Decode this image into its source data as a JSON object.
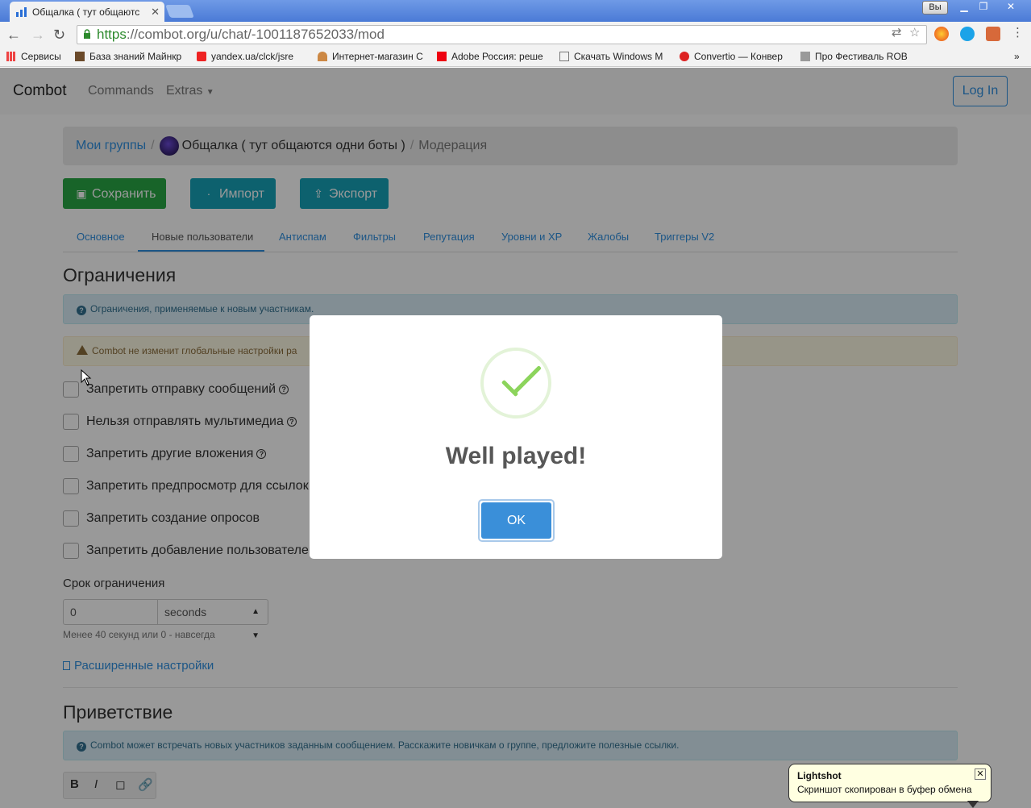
{
  "browser": {
    "tab_title": "Общалка ( тут общаютс",
    "user_button": "Вы",
    "url_https": "https",
    "url_rest": "://combot.org/u/chat/-1001187652033/mod",
    "bookmarks": [
      "Сервисы",
      "База знаний Майнкр",
      "yandex.ua/clck/jsre",
      "Интернет-магазин С",
      "Adobe Россия: реше",
      "Скачать Windows M",
      "Convertio — Конвер",
      "Про Фестиваль ROB"
    ]
  },
  "navbar": {
    "brand": "Combot",
    "commands": "Commands",
    "extras": "Extras",
    "login": "Log In"
  },
  "breadcrumb": {
    "groups": "Мои группы",
    "group_name": "Общалка ( тут общаются одни боты )",
    "current": "Модерация"
  },
  "actions": {
    "save": "Сохранить",
    "import": "Импорт",
    "export": "Экспорт"
  },
  "tabs": [
    "Основное",
    "Новые пользователи",
    "Антиспам",
    "Фильтры",
    "Репутация",
    "Уровни и XP",
    "Жалобы",
    "Триггеры V2"
  ],
  "restrictions": {
    "heading": "Ограничения",
    "info": "Ограничения, применяемые к новым участникам.",
    "warning": "Combot не изменит глобальные настройки ра",
    "options": [
      "Запретить отправку сообщений",
      "Нельзя отправлять мультимедиа",
      "Запретить другие вложения",
      "Запретить предпросмотр для ссылок с",
      "Запретить создание опросов",
      "Запретить добавление пользователей"
    ],
    "duration_label": "Срок ограничения",
    "duration_value": "0",
    "duration_unit": "seconds",
    "hint": "Менее 40 секунд или 0 - навсегда",
    "advanced": "Расширенные настройки"
  },
  "greeting": {
    "heading": "Приветствие",
    "info": "Combot может встречать новых участников заданным сообщением. Расскажите новичкам о группе, предложите полезные ссылки."
  },
  "editor": {
    "bold": "B",
    "italic": "I"
  },
  "modal": {
    "title": "Well played!",
    "ok": "OK"
  },
  "toast": {
    "title": "Lightshot",
    "message": "Скриншот скопирован в буфер обмена"
  },
  "colors": {
    "save_green": "#28a745",
    "info_teal": "#17a2b8",
    "link_blue": "#2f8fe0",
    "check_green": "#8cd45c"
  }
}
